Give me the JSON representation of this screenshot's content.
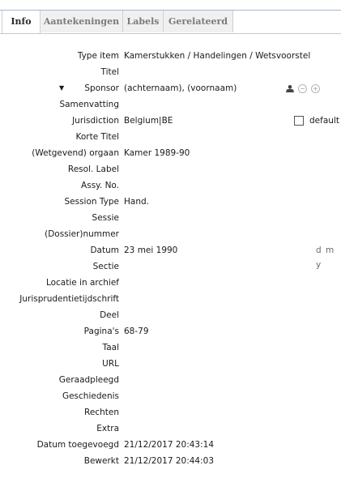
{
  "tabs": [
    "Info",
    "Aantekeningen",
    "Labels",
    "Gerelateerd"
  ],
  "fields": {
    "type_item": {
      "label": "Type item",
      "value": "Kamerstukken / Handelingen / Wetsvoorstel"
    },
    "titel": {
      "label": "Titel",
      "value": ""
    },
    "sponsor": {
      "label": "Sponsor",
      "value": "(achternaam), (voornaam)"
    },
    "samenvatting": {
      "label": "Samenvatting",
      "value": ""
    },
    "jurisdiction": {
      "label": "Jurisdiction",
      "value": "Belgium|BE",
      "checkbox_label": "default"
    },
    "korte_titel": {
      "label": "Korte Titel",
      "value": ""
    },
    "orgaan": {
      "label": "(Wetgevend) orgaan",
      "value": "Kamer 1989-90"
    },
    "resol_label": {
      "label": "Resol. Label",
      "value": ""
    },
    "assy_no": {
      "label": "Assy. No.",
      "value": ""
    },
    "session_type": {
      "label": "Session Type",
      "value": "Hand."
    },
    "sessie": {
      "label": "Sessie",
      "value": ""
    },
    "dossiernummer": {
      "label": "(Dossier)nummer",
      "value": ""
    },
    "datum": {
      "label": "Datum",
      "value": "23 mei 1990",
      "format": "d m y"
    },
    "sectie": {
      "label": "Sectie",
      "value": ""
    },
    "locatie": {
      "label": "Locatie in archief",
      "value": ""
    },
    "jurisprudentie": {
      "label": "Jurisprudentietijdschrift",
      "value": ""
    },
    "deel": {
      "label": "Deel",
      "value": ""
    },
    "paginas": {
      "label": "Pagina's",
      "value": "68-79"
    },
    "taal": {
      "label": "Taal",
      "value": ""
    },
    "url": {
      "label": "URL",
      "value": ""
    },
    "geraadpleegd": {
      "label": "Geraadpleegd",
      "value": ""
    },
    "geschiedenis": {
      "label": "Geschiedenis",
      "value": ""
    },
    "rechten": {
      "label": "Rechten",
      "value": ""
    },
    "extra": {
      "label": "Extra",
      "value": ""
    },
    "datum_toegevoegd": {
      "label": "Datum toegevoegd",
      "value": "21/12/2017 20:43:14"
    },
    "bewerkt": {
      "label": "Bewerkt",
      "value": "21/12/2017 20:44:03"
    }
  },
  "icons": {
    "sponsor_twisty": "triangle-down-icon",
    "creator_type": "person-icon",
    "remove_creator": "minus-circle-icon",
    "add_creator": "plus-circle-icon"
  }
}
